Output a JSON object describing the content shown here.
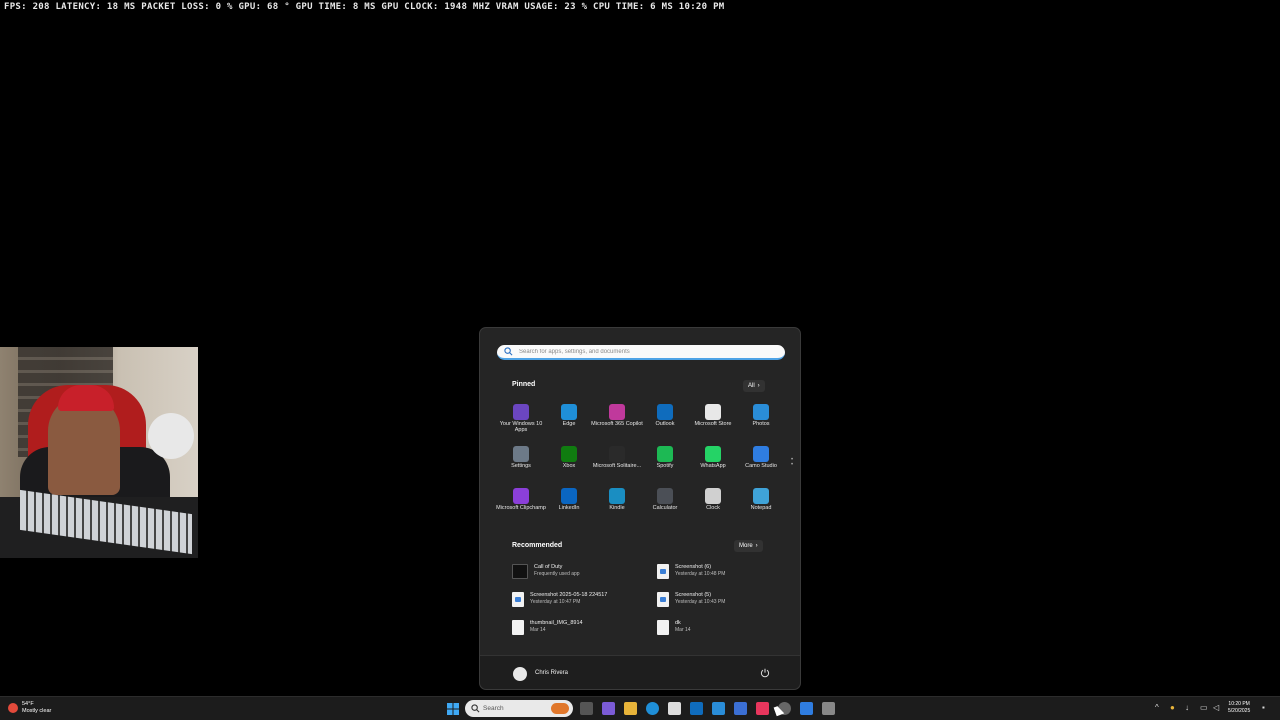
{
  "overlay": {
    "stats": "FPS: 208  LATENCY: 18 MS  PACKET LOSS: 0 %  GPU: 68 °  GPU TIME:  8 MS  GPU CLOCK: 1948 MHZ  VRAM USAGE: 23 %  CPU TIME:  6 MS  10:20 PM"
  },
  "start_menu": {
    "search_placeholder": "Search for apps, settings, and documents",
    "pinned_title": "Pinned",
    "all_label": "All",
    "pinned_apps": [
      {
        "label": "Your Windows 10 Apps",
        "icon": "windows-apps-icon",
        "color": "#6b46c1"
      },
      {
        "label": "Edge",
        "icon": "edge-icon",
        "color": "#1f8fd8"
      },
      {
        "label": "Microsoft 365 Copilot",
        "icon": "copilot-icon",
        "color": "#c0399c"
      },
      {
        "label": "Outlook",
        "icon": "outlook-icon",
        "color": "#0f6cbd"
      },
      {
        "label": "Microsoft Store",
        "icon": "store-icon",
        "color": "#e8e8e8"
      },
      {
        "label": "Photos",
        "icon": "photos-icon",
        "color": "#2a8dd8"
      },
      {
        "label": "Settings",
        "icon": "settings-icon",
        "color": "#6d7a88"
      },
      {
        "label": "Xbox",
        "icon": "xbox-icon",
        "color": "#107c10"
      },
      {
        "label": "Microsoft Solitaire...",
        "icon": "solitaire-icon",
        "color": "#2a2a2a"
      },
      {
        "label": "Spotify",
        "icon": "spotify-icon",
        "color": "#1db954"
      },
      {
        "label": "WhatsApp",
        "icon": "whatsapp-icon",
        "color": "#25d366"
      },
      {
        "label": "Camo Studio",
        "icon": "camo-icon",
        "color": "#2f7de1"
      },
      {
        "label": "Microsoft Clipchamp",
        "icon": "clipchamp-icon",
        "color": "#8b3fd9"
      },
      {
        "label": "LinkedIn",
        "icon": "linkedin-icon",
        "color": "#0a66c2"
      },
      {
        "label": "Kindle",
        "icon": "kindle-icon",
        "color": "#1a8ec2"
      },
      {
        "label": "Calculator",
        "icon": "calculator-icon",
        "color": "#4b4f56"
      },
      {
        "label": "Clock",
        "icon": "clock-icon",
        "color": "#d0d0d0"
      },
      {
        "label": "Notepad",
        "icon": "notepad-icon",
        "color": "#3fa3d8"
      }
    ],
    "recommended_title": "Recommended",
    "more_label": "More",
    "recommended": [
      {
        "name": "Call of Duty",
        "sub": "Frequently used app",
        "icon": "cod"
      },
      {
        "name": "Screenshot (6)",
        "sub": "Yesterday at 10:48 PM",
        "icon": "blue"
      },
      {
        "name": "Screenshot 2025-05-18 224517",
        "sub": "Yesterday at 10:47 PM",
        "icon": "blue"
      },
      {
        "name": "Screenshot (5)",
        "sub": "Yesterday at 10:43 PM",
        "icon": "blue"
      },
      {
        "name": "thumbnail_IMG_8914",
        "sub": "Mar 14",
        "icon": "plain"
      },
      {
        "name": "dk",
        "sub": "Mar 14",
        "icon": "plain"
      }
    ],
    "user_name": "Chris Rivera"
  },
  "taskbar": {
    "weather_temp": "54°F",
    "weather_desc": "Mostly clear",
    "search_placeholder": "Search",
    "clock_time": "10:20 PM",
    "clock_date": "5/20/2025"
  }
}
